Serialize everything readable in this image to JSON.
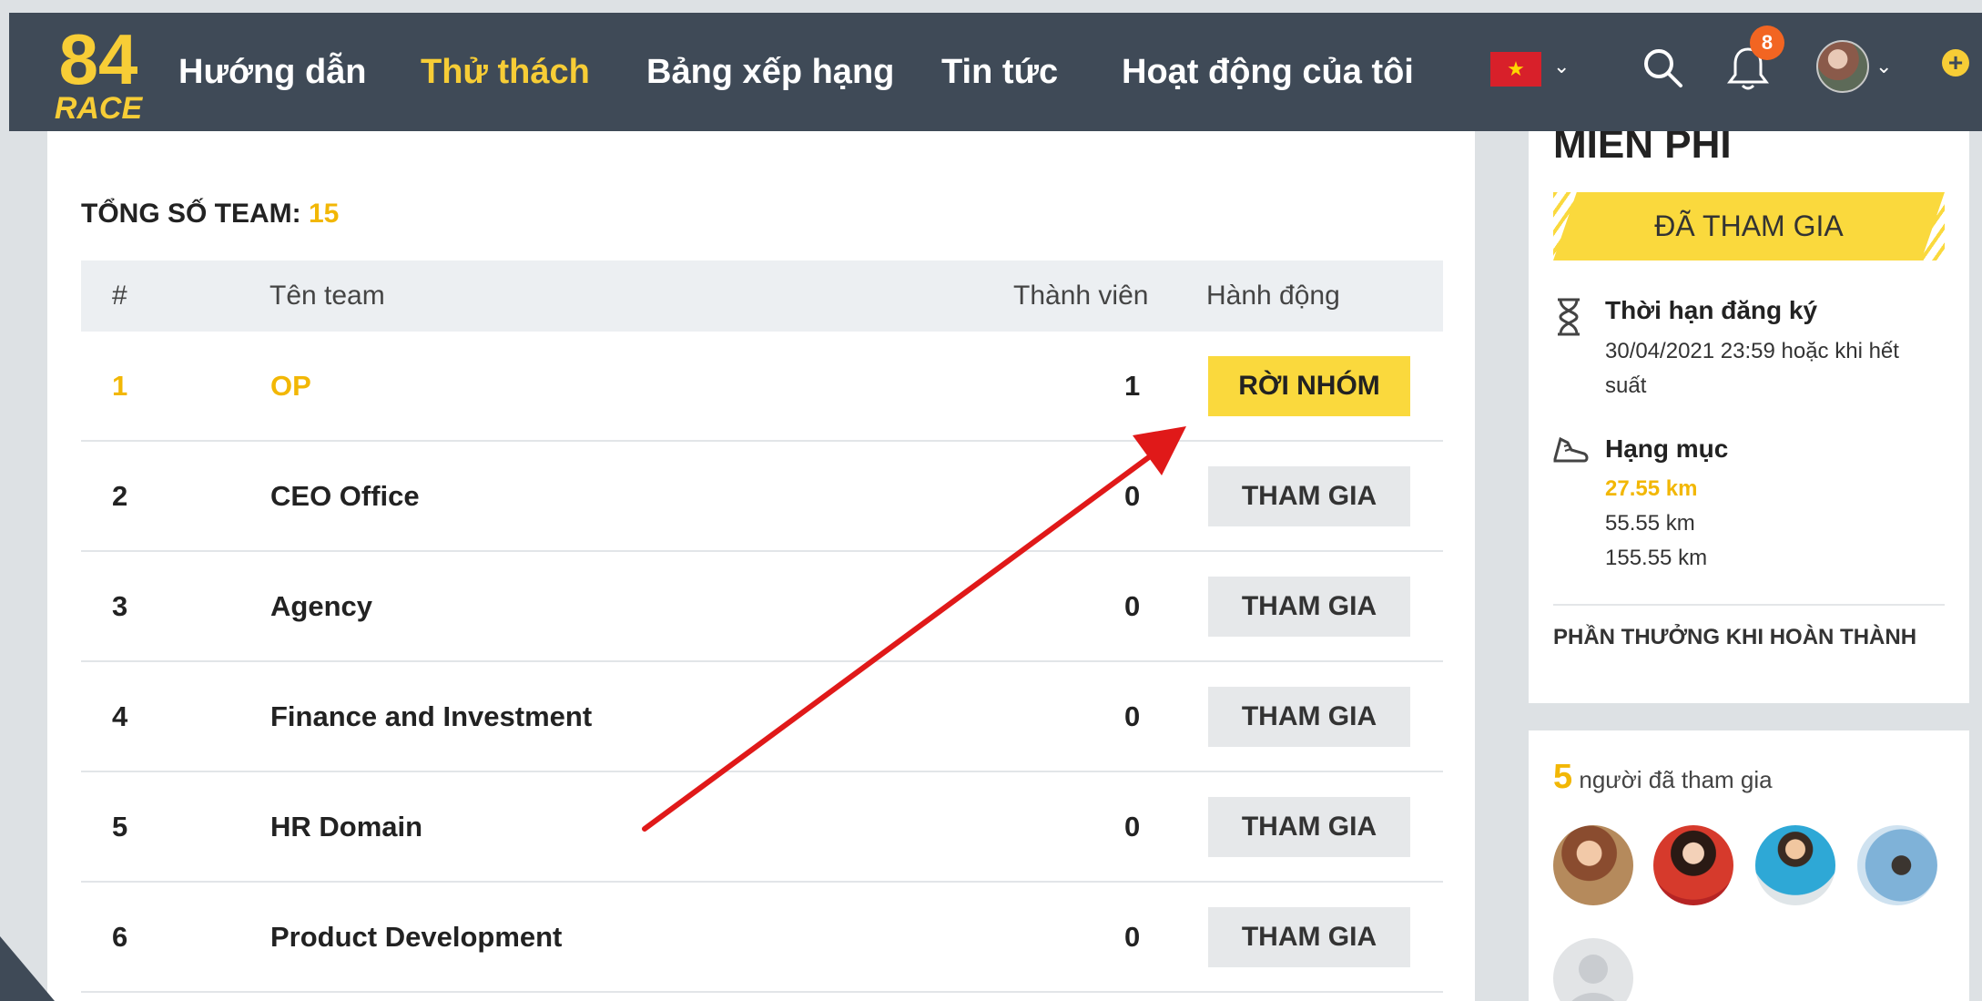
{
  "nav": {
    "logo_line1": "84",
    "logo_line2": "RACE",
    "links": [
      "Hướng dẫn",
      "Thử thách",
      "Bảng xếp hạng",
      "Tin tức",
      "Hoạt động của tôi"
    ],
    "active_index": 1,
    "notification_count": "8",
    "flag_icon": "vietnam-flag-icon",
    "search_icon": "search-icon",
    "bell_icon": "bell-icon",
    "plus_icon": "plus-circle-icon"
  },
  "teams": {
    "total_label": "TỔNG SỐ TEAM:",
    "total_count": "15",
    "columns": [
      "#",
      "Tên team",
      "Thành viên",
      "Hành động"
    ],
    "rows": [
      {
        "idx": "1",
        "name": "OP",
        "members": "1",
        "action": "RỜI NHÓM"
      },
      {
        "idx": "2",
        "name": "CEO Office",
        "members": "0",
        "action": "THAM GIA"
      },
      {
        "idx": "3",
        "name": "Agency",
        "members": "0",
        "action": "THAM GIA"
      },
      {
        "idx": "4",
        "name": "Finance and Investment",
        "members": "0",
        "action": "THAM GIA"
      },
      {
        "idx": "5",
        "name": "HR Domain",
        "members": "0",
        "action": "THAM GIA"
      },
      {
        "idx": "6",
        "name": "Product Development",
        "members": "0",
        "action": "THAM GIA"
      }
    ]
  },
  "sidebar": {
    "price_title": "MIỄN PHÍ",
    "joined_banner": "ĐÃ THAM GIA",
    "deadline_title": "Thời hạn đăng ký",
    "deadline_text_line1": "30/04/2021 23:59 hoặc khi hết",
    "deadline_text_line2": "suất",
    "category_title": "Hạng mục",
    "categories": [
      "27.55 km",
      "55.55 km",
      "155.55 km"
    ],
    "reward_label": "PHẦN THƯỞNG KHI HOÀN THÀNH",
    "participants_count": "5",
    "participants_label": "người đã tham gia"
  },
  "colors": {
    "nav_bg": "#3f4a57",
    "accent_yellow": "#fad93d",
    "highlight": "#f2b705",
    "arrow_red": "#e01919"
  }
}
